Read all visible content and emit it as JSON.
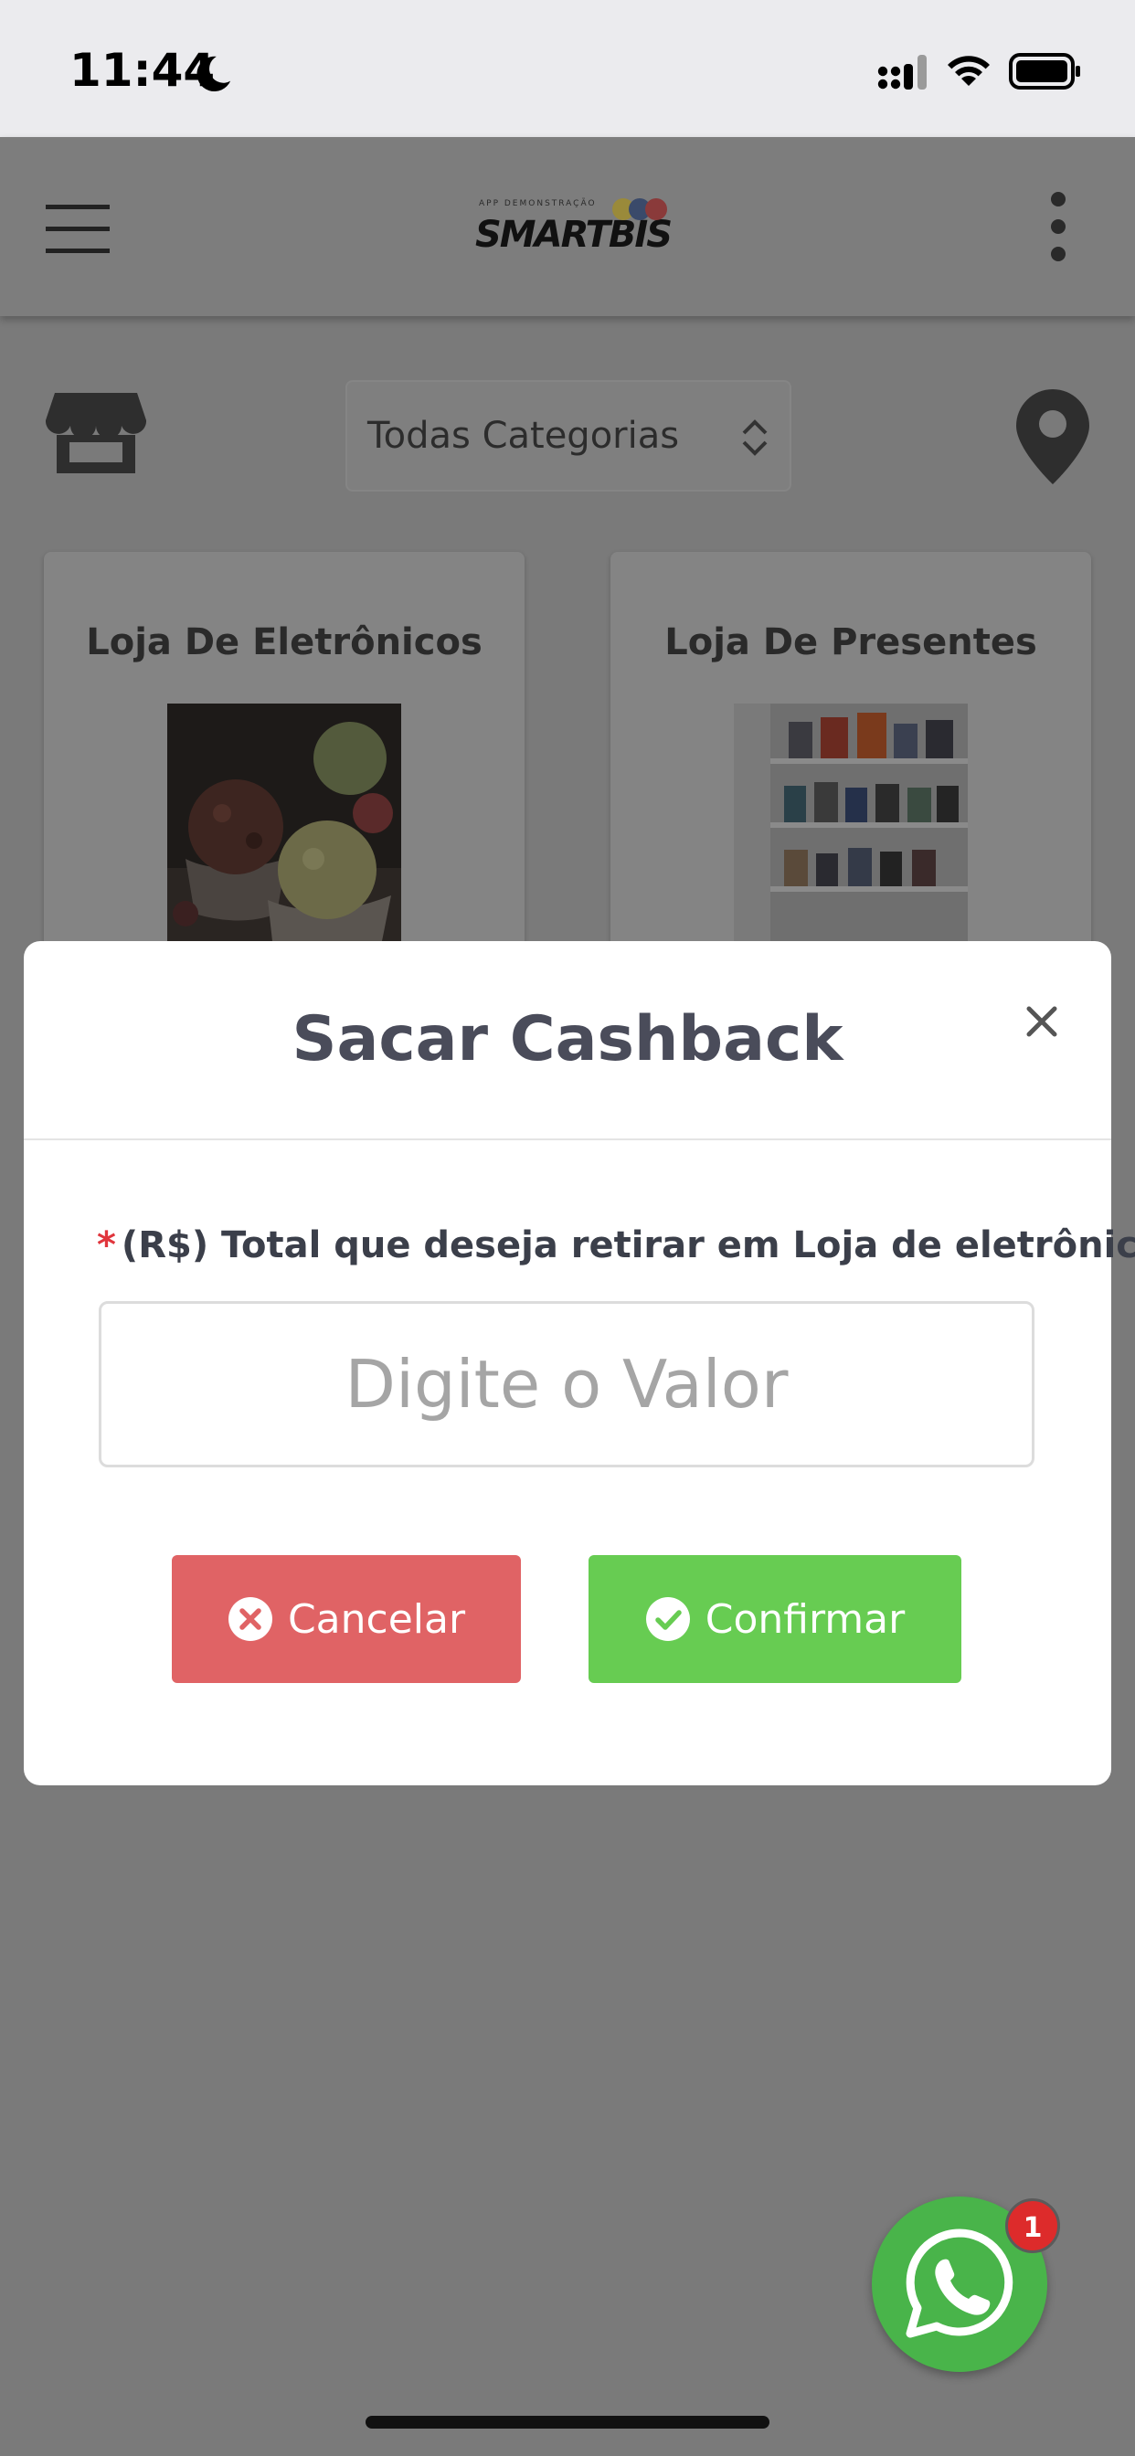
{
  "status_bar": {
    "time": "11:44"
  },
  "header": {
    "logo_subtitle": "APP DEMONSTRAÇÃO",
    "logo_text": "SMARTBIS",
    "logo_dot_colors": [
      "#d9a514",
      "#3b63c4",
      "#d23a3a"
    ]
  },
  "filters": {
    "category_selected": "Todas Categorias"
  },
  "stores": [
    {
      "name": "Loja De Eletrônicos"
    },
    {
      "name": "Loja De Presentes"
    }
  ],
  "modal": {
    "title": "Sacar Cashback",
    "required_mark": "*",
    "field_label": "(R$) Total que deseja retirar em Loja de eletrônicos",
    "input_placeholder": "Digite o Valor",
    "input_value": "",
    "cancel_label": "Cancelar",
    "confirm_label": "Confirmar"
  },
  "whatsapp": {
    "badge_count": "1"
  },
  "colors": {
    "overlay": "#7a7a7a",
    "cancel": "#e06365",
    "confirm": "#67cc52",
    "whatsapp": "#49b44a",
    "badge": "#dd2b2b"
  }
}
